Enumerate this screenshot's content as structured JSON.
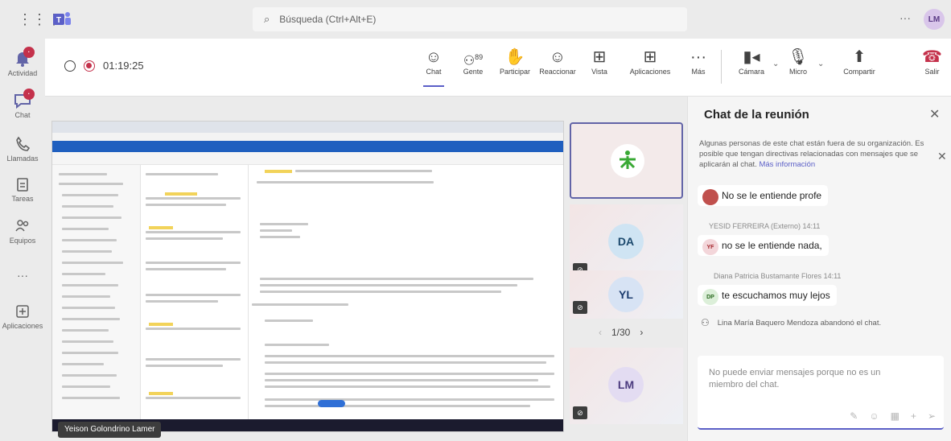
{
  "topbar": {
    "search_placeholder": "Búsqueda (Ctrl+Alt+E)",
    "more": "···",
    "user_initials": "LM",
    "icons": [
      "grid-icon",
      "teams-logo",
      "search-icon",
      "more-icon"
    ]
  },
  "rail": {
    "items": [
      {
        "label": "Actividad",
        "badge": "",
        "icon": "bell-icon"
      },
      {
        "label": "Chat",
        "badge": "",
        "icon": "chat-icon"
      },
      {
        "label": "Llamadas",
        "badge": "",
        "icon": "phone-icon"
      },
      {
        "label": "Tareas",
        "badge": "",
        "icon": "clipboard-icon"
      },
      {
        "label": "Equipos",
        "badge": "",
        "icon": "teams-icon"
      },
      {
        "label": "···",
        "badge": "",
        "icon": "more-icon"
      },
      {
        "label": "Aplicaciones",
        "badge": "",
        "icon": "plus-box-icon"
      }
    ]
  },
  "meeting": {
    "timer": "01:19:25",
    "toolbar": {
      "chat": "Chat",
      "people": "Gente",
      "people_count": "89",
      "raise": "Participar",
      "react": "Reaccionar",
      "view": "Vista",
      "apps": "Aplicaciones",
      "more": "Más",
      "camera": "Cámara",
      "mic": "Micro",
      "share": "Compartir",
      "leave": "Salir"
    }
  },
  "stage": {
    "presenter_caption": "Yeison Golondrino Lamer",
    "tiles": [
      {
        "initials": "",
        "color": "#ffffff"
      },
      {
        "initials": "DA",
        "color": "#cfe4f3"
      },
      {
        "initials": "YL",
        "color": "#d7e3f4"
      },
      {
        "initials": "LM",
        "color": "#e3dcf2"
      }
    ],
    "pager": "1/30"
  },
  "chat": {
    "title": "Chat de la reunión",
    "notice": "Algunas personas de este chat están fuera de su organización. Es posible que tengan directivas relacionadas con mensajes que se aplicarán al chat.",
    "notice_link": "Más información",
    "messages": [
      {
        "sender": "",
        "time": "",
        "text": "No se le entiende profe",
        "initials": ""
      },
      {
        "sender": "YESID FERREIRA (Externo)",
        "time": "14:11",
        "text": "no se le entiende nada,",
        "initials": "YF"
      },
      {
        "sender": "Diana Patricia Bustamante Flores",
        "time": "14:11",
        "text": "te escuchamos muy lejos",
        "initials": "DP"
      }
    ],
    "left_notice": "Lina María Baquero Mendoza abandonó el chat.",
    "composer_text": "No puede enviar mensajes porque no es un miembro del chat."
  }
}
